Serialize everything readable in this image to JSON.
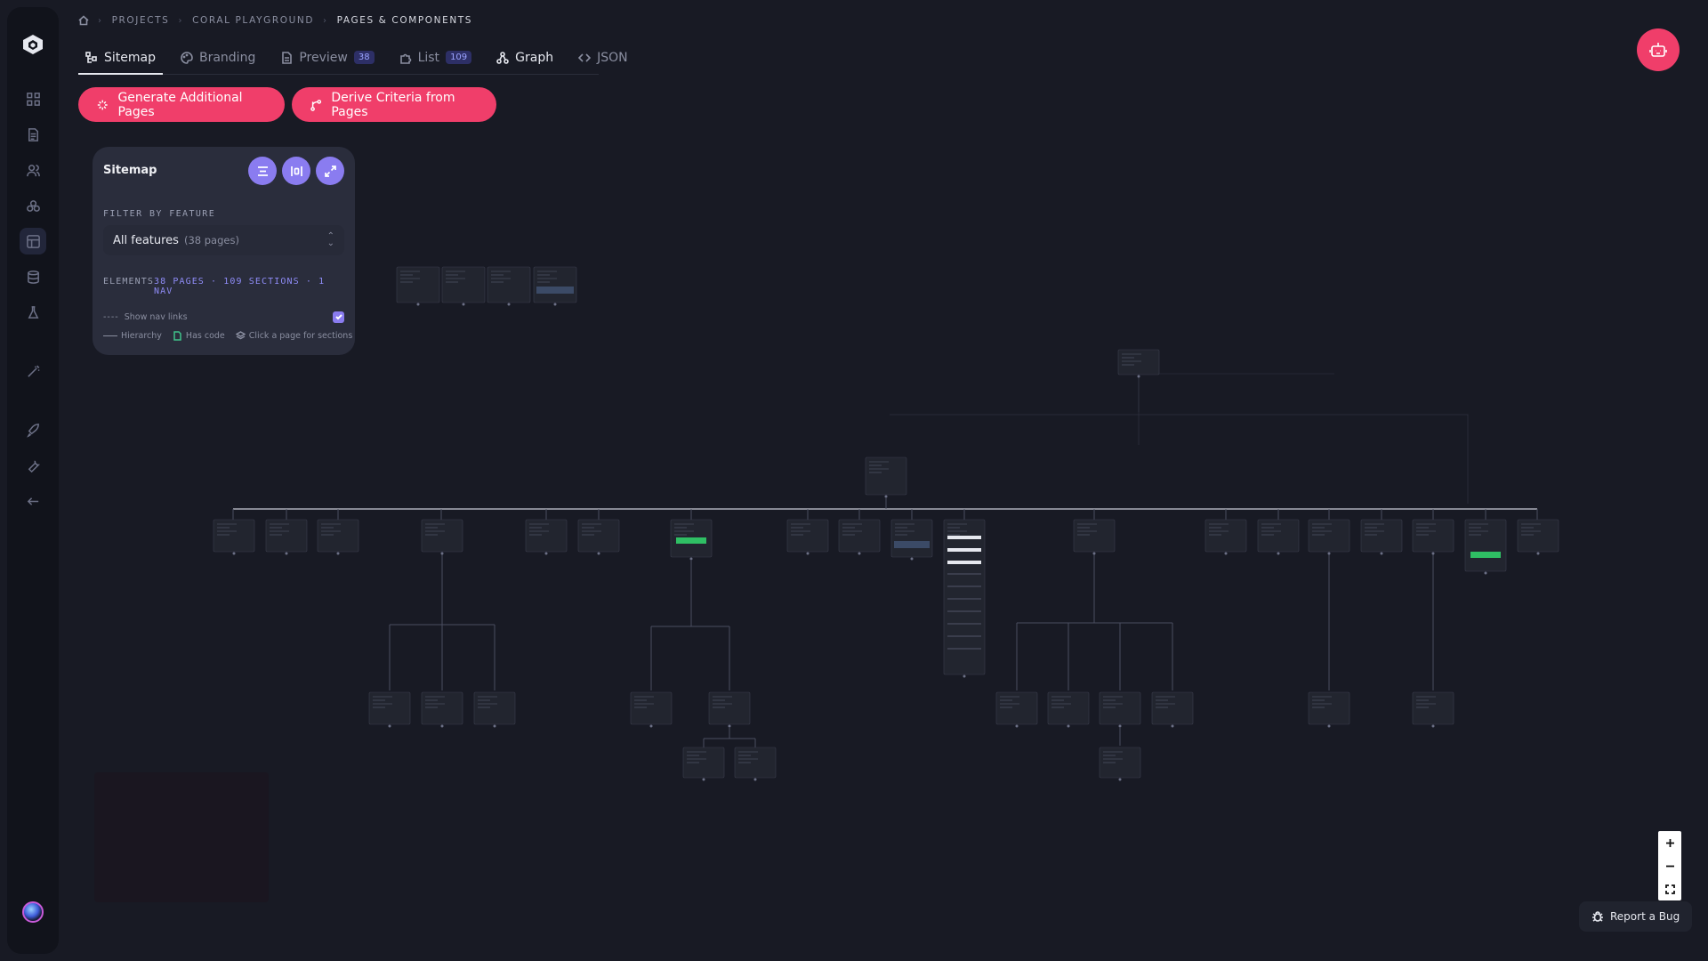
{
  "breadcrumb": [
    "PROJECTS",
    "CORAL PLAYGROUND",
    "PAGES & COMPONENTS"
  ],
  "tabs": [
    {
      "label": "Sitemap",
      "icon": "sitemap-icon",
      "active": true
    },
    {
      "label": "Branding",
      "icon": "palette-icon"
    },
    {
      "label": "Preview",
      "icon": "document-icon",
      "badge": "38"
    },
    {
      "label": "List",
      "icon": "puzzle-icon",
      "badge": "109"
    },
    {
      "label": "Graph",
      "icon": "graph-icon"
    },
    {
      "label": "JSON",
      "icon": "code-icon"
    }
  ],
  "actions": {
    "generate_label": "Generate Additional Pages",
    "derive_label": "Derive Criteria from Pages"
  },
  "sitemap_panel": {
    "title": "Sitemap",
    "filter_label": "FILTER BY FEATURE",
    "filter_value": "All features",
    "filter_count": "(38 pages)",
    "elements_label": "ELEMENTS",
    "elements_value": "38 PAGES · 109 SECTIONS · 1 NAV",
    "nav_dash": "----",
    "show_nav_label": "Show nav links",
    "show_nav_checked": true,
    "legend_hierarchy": "Hierarchy",
    "legend_code": "Has code",
    "legend_click": "Click a page for sections"
  },
  "report_bug_label": "Report a Bug",
  "colors": {
    "accent": "#f03e6a",
    "panel_button": "#8a7cf0",
    "badge_text": "#9ba3ff",
    "background": "#181a24"
  }
}
